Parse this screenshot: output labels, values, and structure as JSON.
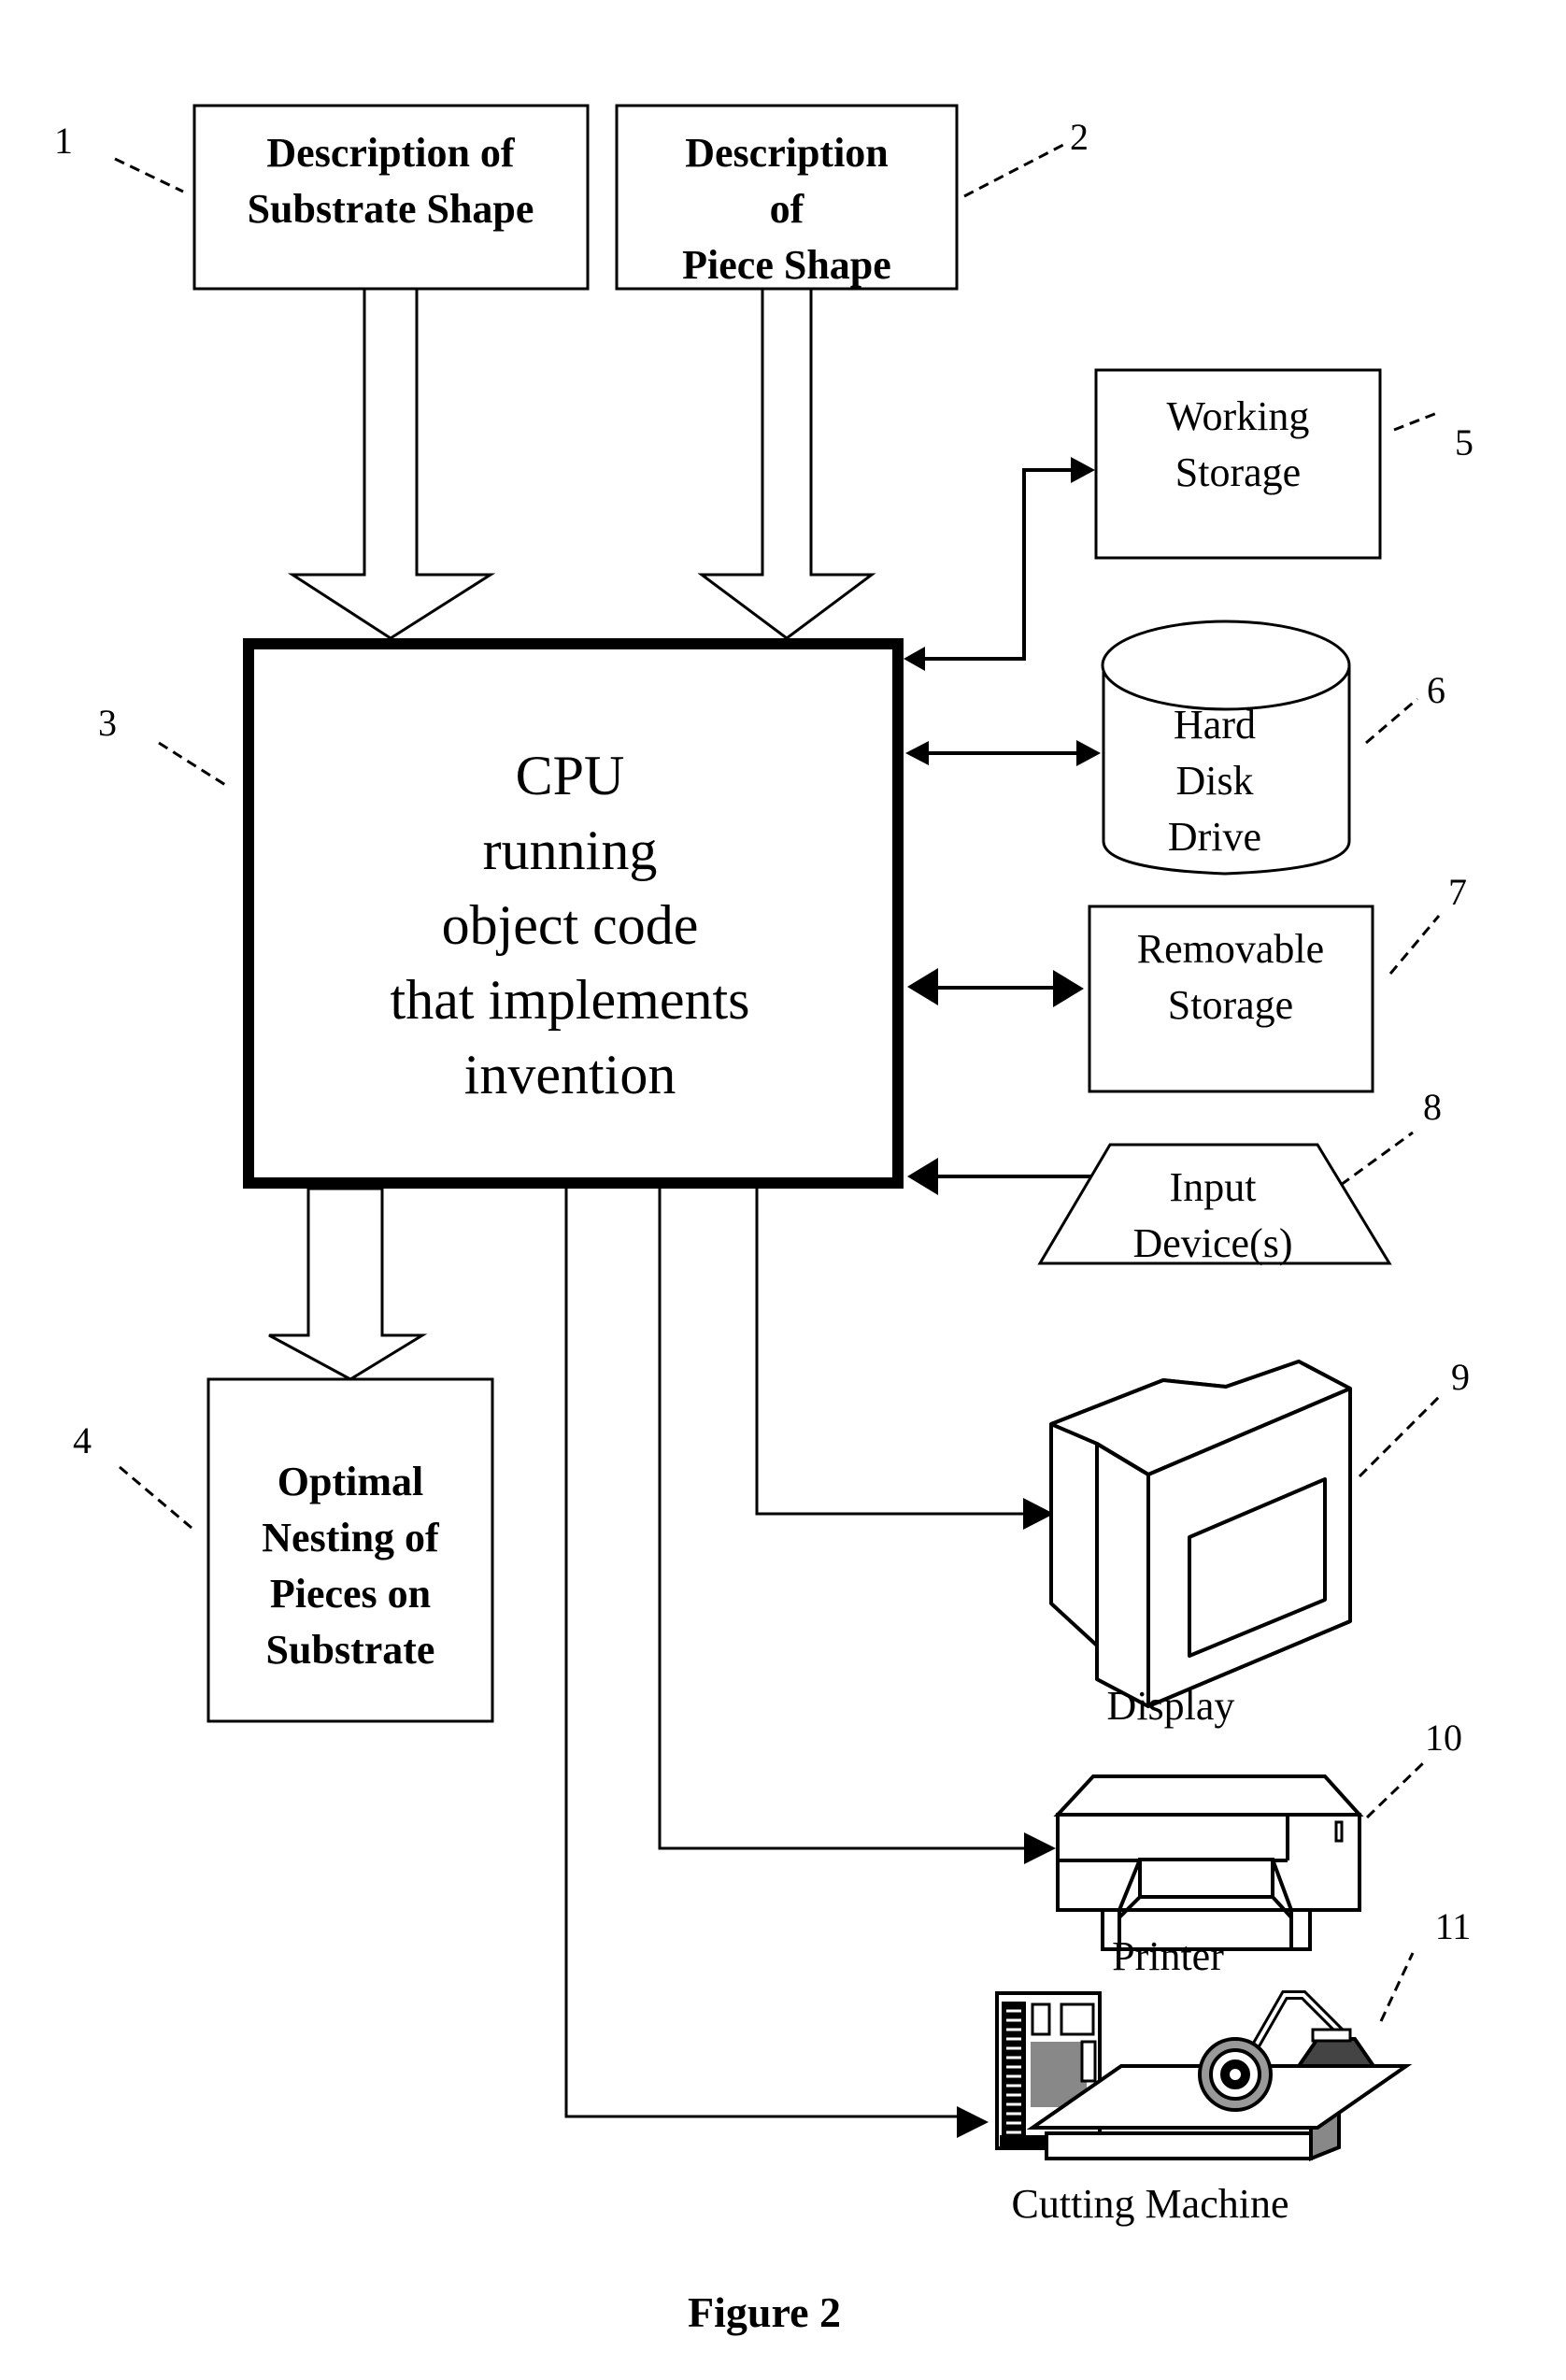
{
  "figure": {
    "caption": "Figure 2"
  },
  "colors": {
    "ink": "#000000",
    "paper": "#ffffff"
  },
  "nodes": {
    "substrate_description": {
      "ref": "1",
      "lines": [
        "Description of",
        "Substrate Shape"
      ]
    },
    "piece_description": {
      "ref": "2",
      "lines": [
        "Description",
        "of",
        "Piece Shape"
      ]
    },
    "cpu": {
      "ref": "3",
      "lines": [
        "CPU",
        "running",
        "object code",
        "that implements",
        "invention"
      ]
    },
    "optimal_nesting": {
      "ref": "4",
      "lines": [
        "Optimal",
        "Nesting of",
        "Pieces on",
        "Substrate"
      ]
    },
    "working_storage": {
      "ref": "5",
      "lines": [
        "Working",
        "Storage"
      ]
    },
    "hard_disk": {
      "ref": "6",
      "lines": [
        "Hard",
        "Disk",
        "Drive"
      ]
    },
    "removable_storage": {
      "ref": "7",
      "lines": [
        "Removable",
        "Storage"
      ]
    },
    "input_devices": {
      "ref": "8",
      "lines": [
        "Input",
        "Device(s)"
      ]
    },
    "display": {
      "ref": "9",
      "label": "Display",
      "icon": "monitor-icon"
    },
    "printer": {
      "ref": "10",
      "label": "Printer",
      "icon": "printer-icon"
    },
    "cutting_machine": {
      "ref": "11",
      "label": "Cutting Machine",
      "icon": "cutting-machine-icon"
    }
  },
  "edges": [
    {
      "from": "substrate_description",
      "to": "cpu",
      "style": "block-arrow"
    },
    {
      "from": "piece_description",
      "to": "cpu",
      "style": "block-arrow"
    },
    {
      "from": "cpu",
      "to": "optimal_nesting",
      "style": "block-arrow"
    },
    {
      "from": "cpu",
      "to": "working_storage",
      "style": "bidirectional"
    },
    {
      "from": "cpu",
      "to": "hard_disk",
      "style": "bidirectional"
    },
    {
      "from": "cpu",
      "to": "removable_storage",
      "style": "bidirectional"
    },
    {
      "from": "input_devices",
      "to": "cpu",
      "style": "arrow"
    },
    {
      "from": "cpu",
      "to": "display",
      "style": "arrow"
    },
    {
      "from": "cpu",
      "to": "printer",
      "style": "arrow"
    },
    {
      "from": "cpu",
      "to": "cutting_machine",
      "style": "arrow"
    }
  ]
}
